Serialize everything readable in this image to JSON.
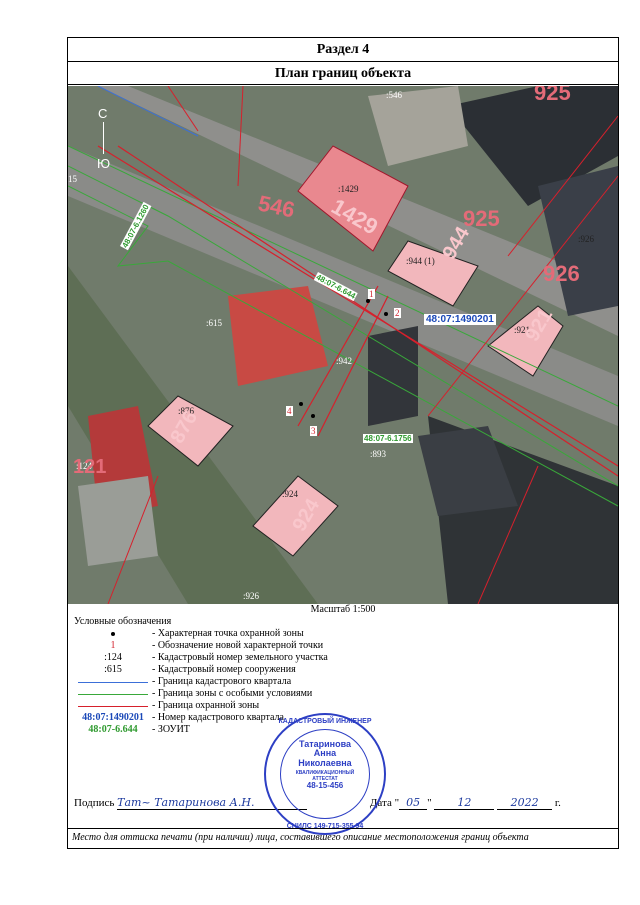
{
  "header": {
    "section": "Раздел 4",
    "plan_title": "План границ объекта"
  },
  "map": {
    "north_label": "С",
    "south_label": "Ю",
    "labels": {
      "p546_top": ":546",
      "p925_big": "925",
      "p546_big": "546",
      "p1429_small": ":1429",
      "p1429_big": "1429",
      "p925_big2": "925",
      "p944_small": ":944 (1)",
      "p944_big": "944",
      "p926_small": ":926",
      "p926_big": "926",
      "p921_small": ":921",
      "p921_big": "921",
      "p876_small": ":876",
      "p876_big": "876",
      "p124_small": ":124",
      "p124_big": "121",
      "p924_small": ":924",
      "p924_big": "924",
      "p893_small": ":893",
      "p615_small": ":615",
      "p942_small": ":942",
      "p926_bottom": ":926",
      "left_15": "15",
      "quarter": "48:07:1490201",
      "zone1": "48:07-6.1260",
      "zone2": "48:07-6.644",
      "zone3": "48:07-6.1756",
      "pt1": "1",
      "pt2": "2",
      "pt3": "3",
      "pt4": "4"
    }
  },
  "scale": "Масштаб 1:500",
  "legend": {
    "title": "Условные обозначения",
    "items": [
      {
        "symbol": "",
        "text": "- Характерная точка охранной зоны"
      },
      {
        "symbol": "1",
        "text": "- Обозначение новой характерной точки"
      },
      {
        "symbol": ":124",
        "text": "- Кадастровый номер земельного участка"
      },
      {
        "symbol": ":615",
        "text": "- Кадастровый номер сооружения"
      },
      {
        "symbol": "",
        "text": "- Граница кадастрового квартала"
      },
      {
        "symbol": "",
        "text": "- Граница зоны с особыми условиями"
      },
      {
        "symbol": "",
        "text": "- Граница охранной зоны"
      },
      {
        "symbol": "48:07:1490201",
        "text": "- Номер кадастрового квартала"
      },
      {
        "symbol": "48:07-6.644",
        "text": "- ЗОУИТ"
      }
    ]
  },
  "colors": {
    "quarter_line": "#3b6fd8",
    "zone_line": "#39a83a",
    "guard_line": "#d6202c",
    "stamp": "#2d3fc4"
  },
  "signature": {
    "label": "Подпись",
    "handwriting": "Тат~ Татаринова А.Н.",
    "date_label": "Дата \"",
    "day": "05",
    "month": "12",
    "year": "2022",
    "year_suffix": "г."
  },
  "stamp": {
    "ring_text": "КАДАСТРОВЫЙ ИНЖЕНЕР",
    "name1": "Татаринова",
    "name2": "Анна",
    "name3": "Николаевна",
    "cert1": "КВАЛИФИКАЦИОННЫЙ",
    "cert2": "АТТЕСТАТ",
    "cert_no": "48-15-456",
    "snils": "СНИЛС 149-715-355 94"
  },
  "footer": "Место для оттиска печати (при наличии) лица, составившего описание местоположения границ объекта"
}
